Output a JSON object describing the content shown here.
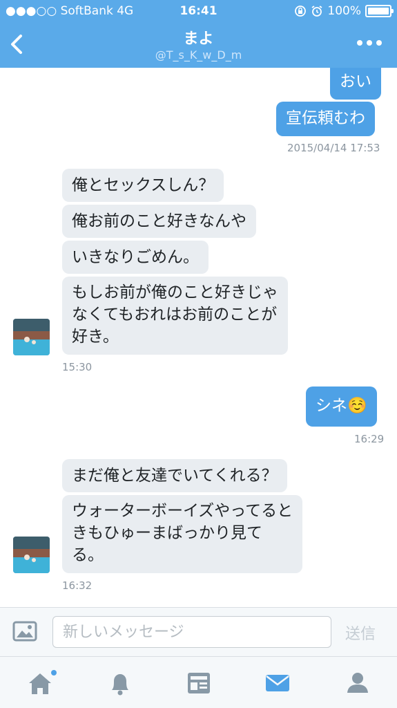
{
  "status_bar": {
    "carrier": "●●●○○ SoftBank  4G",
    "time": "16:41",
    "battery": "100%"
  },
  "header": {
    "title": "まよ",
    "handle": "@T_s_K_w_D_m"
  },
  "messages": [
    {
      "text": "おい",
      "dir": "sent"
    },
    {
      "text": "宣伝頼むわ",
      "dir": "sent"
    },
    {
      "stamp": "2015/04/14 17:53"
    },
    {
      "text": "俺とセックスしん？",
      "dir": "recv"
    },
    {
      "text": "俺お前のこと好きなんや",
      "dir": "recv"
    },
    {
      "text": "いきなりごめん。",
      "dir": "recv"
    },
    {
      "text": "もしお前が俺のこと好きじゃ\nなくてもおれはお前のことが\n好き。",
      "dir": "recv"
    },
    {
      "stamp": "15:30"
    },
    {
      "text": "シネ☺️",
      "dir": "sent"
    },
    {
      "stamp": "16:29"
    },
    {
      "text": "まだ俺と友達でいてくれる？",
      "dir": "recv"
    },
    {
      "text": "ウォーターボーイズやってると\nきもひゅーまばっかり見て\nる。",
      "dir": "recv"
    },
    {
      "stamp": "16:32"
    }
  ],
  "composer": {
    "placeholder": "新しいメッセージ",
    "send_label": "送信"
  },
  "tabs": [
    {
      "icon": "home-icon",
      "notification_dot": true
    },
    {
      "icon": "bell-icon"
    },
    {
      "icon": "moments-icon"
    },
    {
      "icon": "messages-icon",
      "active": true
    },
    {
      "icon": "profile-icon"
    }
  ],
  "colors": {
    "header": "#5aaae9",
    "sent_bubble": "#4ea1e6",
    "received_bubble": "#e9edf1",
    "tab_active": "#4ea1e6",
    "tab_inactive": "#8899a6"
  }
}
